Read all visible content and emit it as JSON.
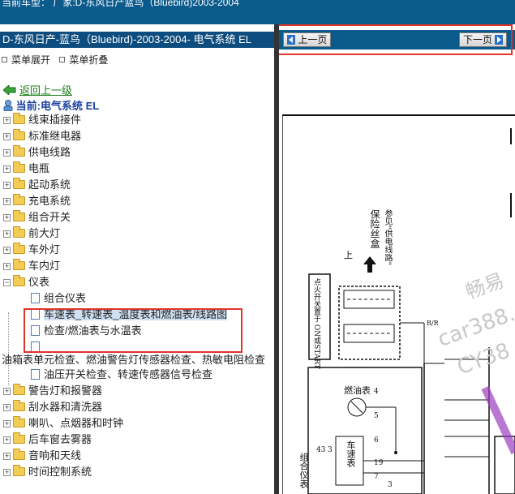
{
  "topbar": {
    "text": "当前车型：  厂家:D-东风日产蓝鸟（Bluebird)2003-2004"
  },
  "left_panel": {
    "title": "D-东风日产-蓝鸟（Bluebird)-2003-2004- 电气系统 EL",
    "expand_all": "菜单展开",
    "collapse_all": "菜单折叠",
    "back_link": "返回上一级",
    "current": "当前:电气系统 EL",
    "tree": [
      {
        "label": "线束插接件"
      },
      {
        "label": "标准继电器"
      },
      {
        "label": "供电线路"
      },
      {
        "label": "电瓶"
      },
      {
        "label": "起动系统"
      },
      {
        "label": "充电系统"
      },
      {
        "label": "组合开关"
      },
      {
        "label": "前大灯"
      },
      {
        "label": "车外灯"
      },
      {
        "label": "车内灯"
      },
      {
        "label": "仪表"
      }
    ],
    "instrument_children": [
      {
        "label": "组合仪表"
      },
      {
        "label": "车速表_转速表_温度表和燃油表/线路图"
      },
      {
        "label": "检查/燃油表与水温表"
      },
      {
        "label": ""
      }
    ],
    "overflow_line": "油箱表单元检查、燃油警告灯传感器检查、热敏电阻检查",
    "overflow_child": "油压开关检查、转速传感器信号检查",
    "tree_after": [
      {
        "label": "警告灯和报警器"
      },
      {
        "label": "刮水器和清洗器"
      },
      {
        "label": "喇叭、点烟器和时钟"
      },
      {
        "label": "后车窗去雾器"
      },
      {
        "label": "音响和天线"
      },
      {
        "label": "时间控制系统"
      }
    ]
  },
  "right_panel": {
    "prev_label": "上一页",
    "next_label": "下一页",
    "diagram": {
      "fuse_label": "保险丝盒",
      "fuse_ref": "参见\"供电线路\"",
      "ignition_label": "点火开关置于 ON或START",
      "fuel_gauge": "燃油表",
      "speedometer": "车速表",
      "combo_label": "组合仪表",
      "up_label": "上",
      "br_label": "B/R",
      "pins": [
        "43",
        "3",
        "4",
        "5",
        "6",
        "19",
        "7",
        "3"
      ],
      "watermark_1": "畅易",
      "watermark_2": "car388.",
      "watermark_3": "CY38"
    }
  },
  "colors": {
    "title_bg": "#0d4c7e",
    "bar_bg": "#0a5a8c",
    "highlight": "#e0342a",
    "current_text": "#1c3fa0",
    "back_link": "#1a7f1a",
    "selected_bg": "#cfe0f2"
  }
}
